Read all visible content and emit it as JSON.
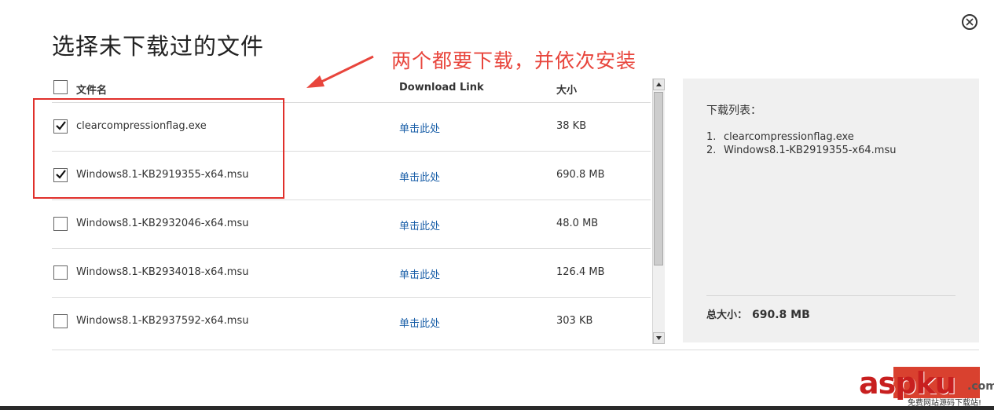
{
  "dialog": {
    "title": "选择未下载过的文件"
  },
  "annotation": {
    "text": "两个都要下载，并依次安装",
    "color": "#e8453c"
  },
  "table": {
    "columns": [
      "文件名",
      "Download Link",
      "大小"
    ],
    "rows": [
      {
        "checked": true,
        "file": "clearcompressionflag.exe",
        "link": "单击此处",
        "size": "38 KB"
      },
      {
        "checked": true,
        "file": "Windows8.1-KB2919355-x64.msu",
        "link": "单击此处",
        "size": "690.8 MB"
      },
      {
        "checked": false,
        "file": "Windows8.1-KB2932046-x64.msu",
        "link": "单击此处",
        "size": "48.0 MB"
      },
      {
        "checked": false,
        "file": "Windows8.1-KB2934018-x64.msu",
        "link": "单击此处",
        "size": "126.4 MB"
      },
      {
        "checked": false,
        "file": "Windows8.1-KB2937592-x64.msu",
        "link": "单击此处",
        "size": "303 KB"
      }
    ]
  },
  "panel": {
    "title": "下载列表：",
    "items": [
      {
        "num": "1.",
        "name": "clearcompressionflag.exe"
      },
      {
        "num": "2.",
        "name": "Windows8.1-KB2919355-x64.msu"
      }
    ],
    "total_label": "总大小：",
    "total_value": "690.8 MB"
  },
  "watermark": {
    "main": "aspku",
    "suffix": ".com",
    "sub": "免费网站源码下载站!"
  },
  "colors": {
    "accent_red": "#d9412f",
    "link_blue": "#1a5fa8",
    "panel_bg": "#f0f0f0"
  }
}
